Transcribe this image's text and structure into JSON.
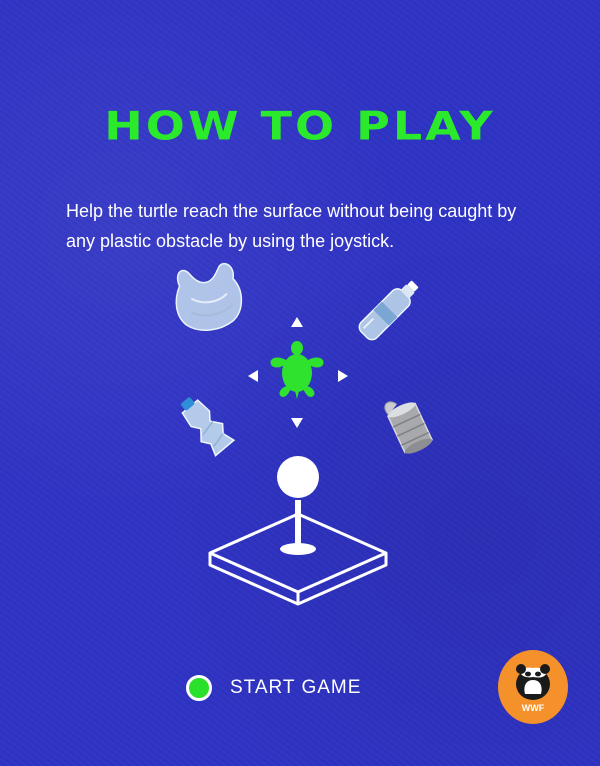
{
  "screen": {
    "title": "HOW TO PLAY",
    "instructions": "Help the turtle reach the surface without being caught by any plastic obstacle by using the joystick.",
    "start_label": "START GAME",
    "brand_text": "WWF"
  },
  "colors": {
    "background": "#2f33c4",
    "accent_green": "#2bea2b",
    "text": "#ffffff",
    "brand_orange": "#f5912b"
  },
  "icons": {
    "obstacles": [
      "plastic-bag-icon",
      "plastic-bottle-icon",
      "crushed-bottle-icon",
      "tin-can-icon"
    ],
    "player": "turtle-icon",
    "directions": [
      "arrow-up-icon",
      "arrow-down-icon",
      "arrow-left-icon",
      "arrow-right-icon"
    ],
    "controller": "joystick-icon"
  }
}
